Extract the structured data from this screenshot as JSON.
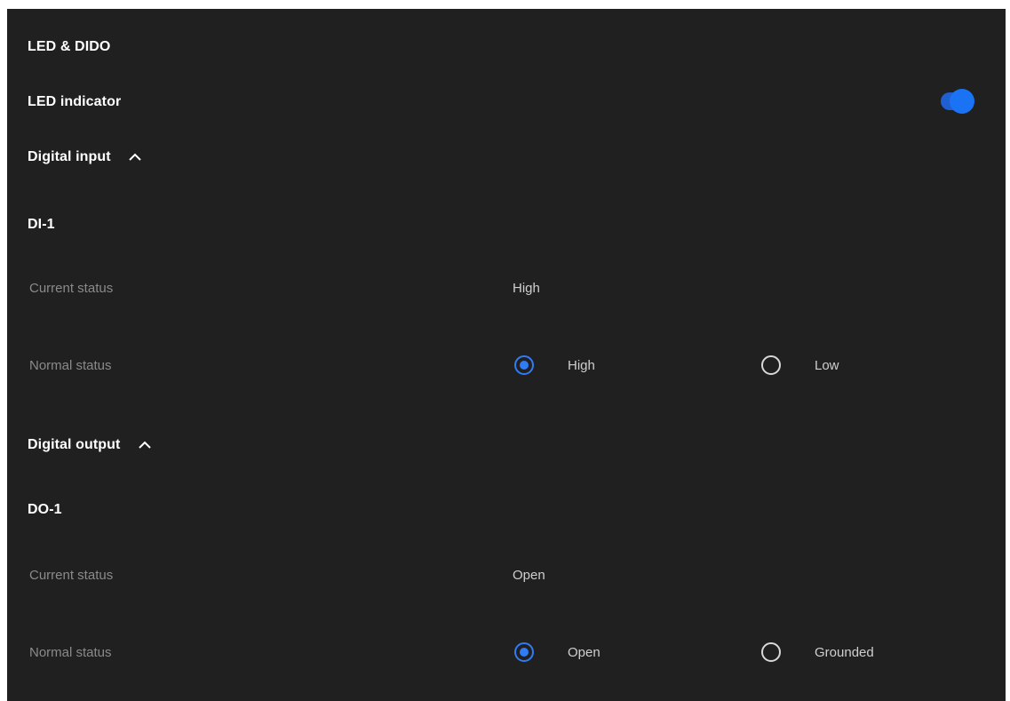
{
  "title": "LED & DIDO",
  "led": {
    "label": "LED indicator",
    "enabled": true
  },
  "digital_input": {
    "label": "Digital input",
    "expanded": true,
    "channel": "DI-1",
    "current_status_label": "Current status",
    "current_status_value": "High",
    "normal_status_label": "Normal status",
    "options": [
      "High",
      "Low"
    ],
    "selected": "High"
  },
  "digital_output": {
    "label": "Digital output",
    "expanded": true,
    "channel": "DO-1",
    "current_status_label": "Current status",
    "current_status_value": "Open",
    "normal_status_label": "Normal status",
    "options": [
      "Open",
      "Grounded"
    ],
    "selected": "Open"
  },
  "colors": {
    "background": "#202020",
    "accent": "#1a73f5",
    "label": "#8a8a8a"
  }
}
